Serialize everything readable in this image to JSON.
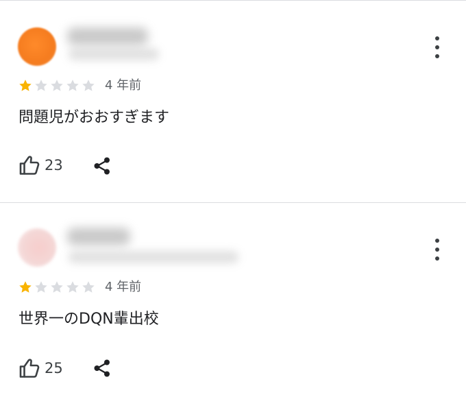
{
  "reviews": [
    {
      "rating": 1,
      "max_rating": 5,
      "age": "4 年前",
      "text": "問題児がおおすぎます",
      "like_count": "23"
    },
    {
      "rating": 1,
      "max_rating": 5,
      "age": "4 年前",
      "text": "世界一のDQN輩出校",
      "like_count": "25"
    }
  ],
  "icons": {
    "star_filled": "star-filled-icon",
    "star_empty": "star-empty-icon",
    "thumbs_up": "thumbs-up-icon",
    "share": "share-icon",
    "more": "more-vert-icon"
  },
  "colors": {
    "star_filled": "#f9b300",
    "star_empty": "#dadce0",
    "divider": "#dadce0"
  }
}
